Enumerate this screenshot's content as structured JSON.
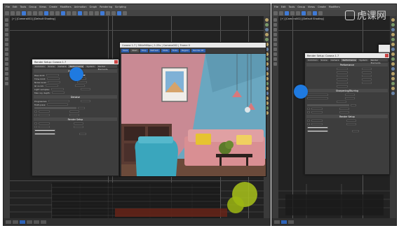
{
  "left_app": {
    "menu": [
      "File",
      "Edit",
      "Tools",
      "Group",
      "Views",
      "Create",
      "Modifiers",
      "Animation",
      "Graph",
      "Rendering",
      "Scripting"
    ],
    "viewport_label": "[+] [Camera002] [Default Shading]"
  },
  "right_app": {
    "menu": [
      "File",
      "Edit",
      "Tools",
      "Group",
      "Views",
      "Create",
      "Modifiers"
    ],
    "viewport_label": "[+] [Camera002] [Default Shading]"
  },
  "render_setup_left": {
    "title": "Render Setup: Corona 1.7",
    "tabs": [
      "Common",
      "Scene",
      "Camera",
      "Performance",
      "System",
      "Render Elements"
    ],
    "section_top": "Performance",
    "section_mid": "Denoise",
    "section_bot": "Render Setup",
    "rows": [
      {
        "label": "Pass limit:",
        "value": ""
      },
      {
        "label": "Time limit:",
        "value": ""
      },
      {
        "label": "Noise level:",
        "value": ""
      },
      {
        "label": "GI vs AA:",
        "value": ""
      },
      {
        "label": "Light samples:",
        "value": ""
      },
      {
        "label": "Max ray depth:",
        "value": ""
      },
      {
        "label": "Progressive:",
        "value": ""
      },
      {
        "label": "Multi-pass:",
        "value": ""
      }
    ]
  },
  "render_setup_right": {
    "title": "Render Setup: Corona 1.7",
    "tabs": [
      "Common",
      "Scene",
      "Camera",
      "Performance",
      "System",
      "Render Elements"
    ],
    "section_top": "Performance",
    "section_mid": "Sharpening/Blurring",
    "section_bot": "Render Setup"
  },
  "frame_buffer": {
    "title": "Corona 1.7 | 584x960px | 1:25s | Camera002 | Frame 0",
    "toolbar": [
      "Save",
      "Start",
      "Stop",
      "Refresh",
      "Stats",
      "Tools",
      "Region",
      "Render RT"
    ]
  },
  "watermark": {
    "text": "虎课网"
  },
  "colors": {
    "accent": "#1f7ae0",
    "wall_pink": "#c98a94",
    "wall_blue": "#6aa7c0",
    "sofa": "#d98f93",
    "chair": "#3aa6bd"
  }
}
